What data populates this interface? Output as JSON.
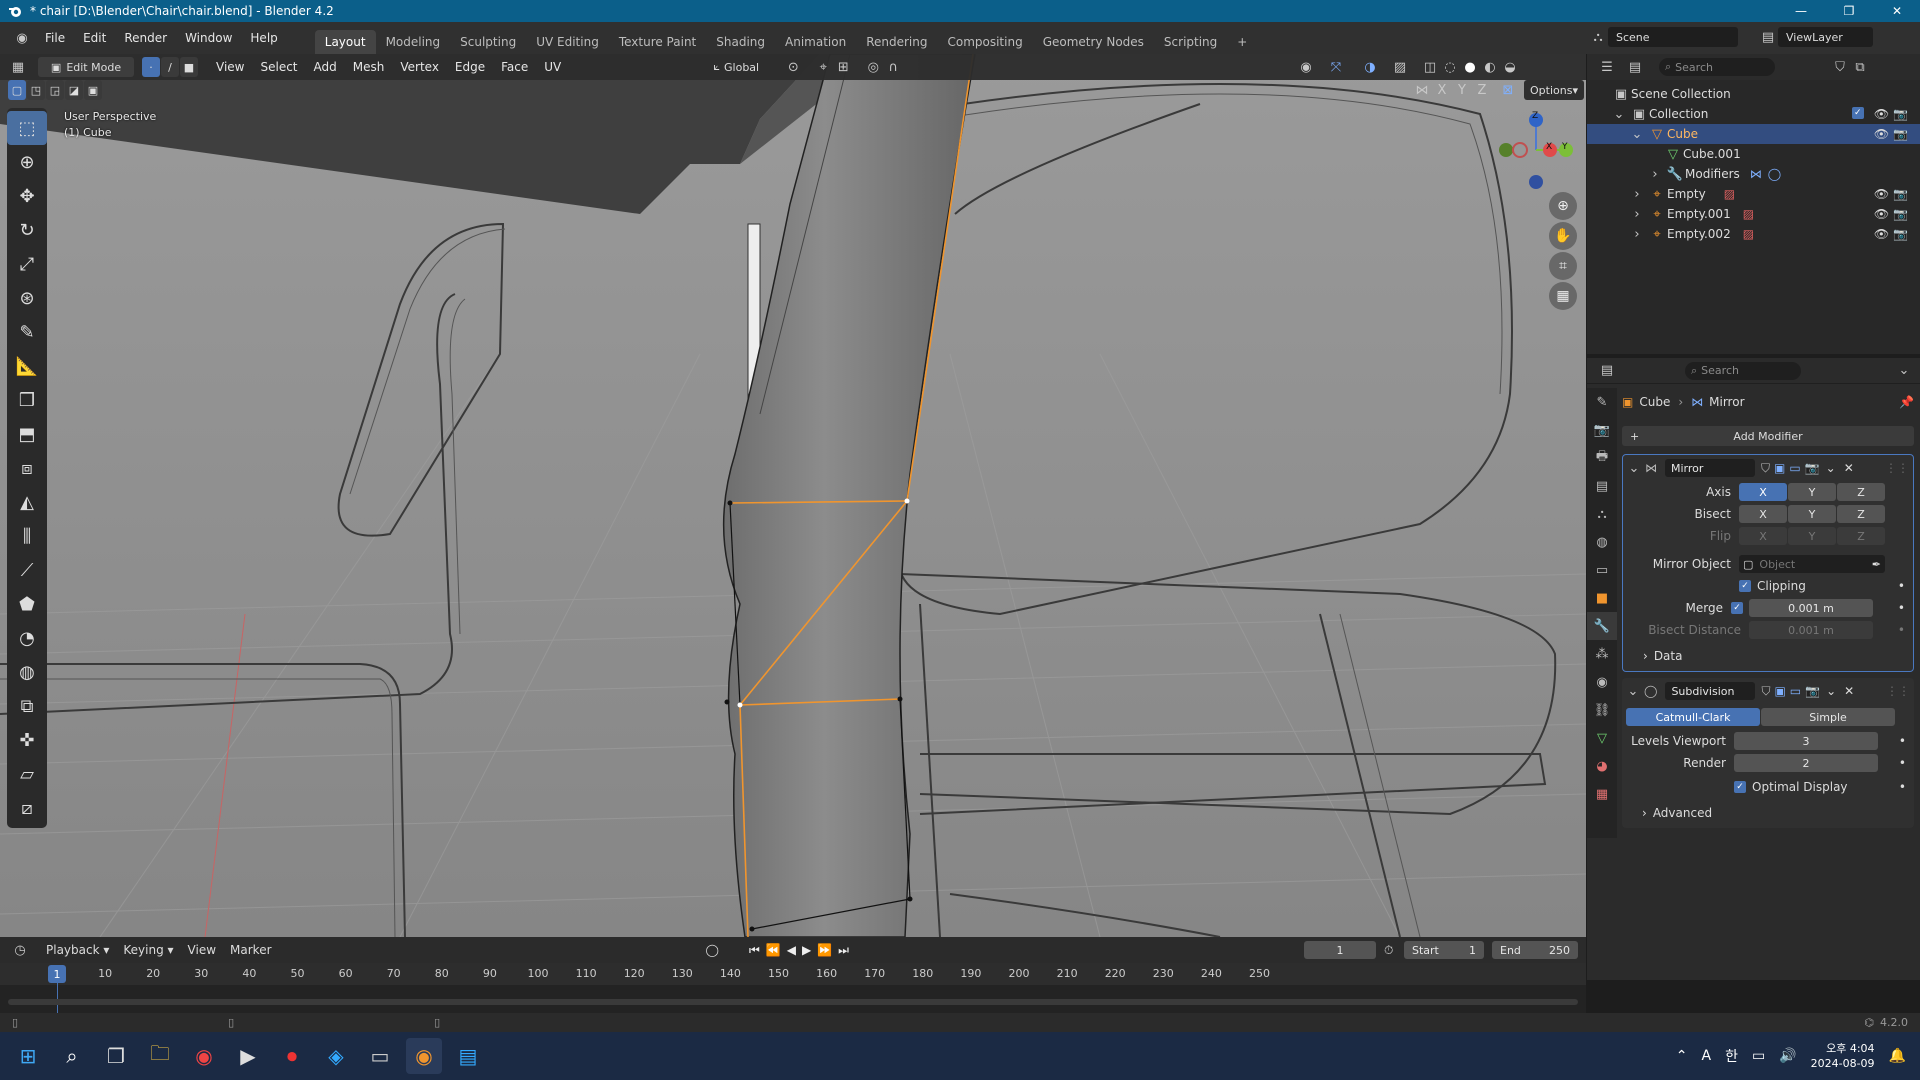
{
  "window": {
    "title": "* chair [D:\\Blender\\Chair\\chair.blend] - Blender 4.2",
    "controls": [
      "—",
      "❐",
      "✕"
    ]
  },
  "menus": [
    "File",
    "Edit",
    "Render",
    "Window",
    "Help"
  ],
  "workspaces": [
    "Layout",
    "Modeling",
    "Sculpting",
    "UV Editing",
    "Texture Paint",
    "Shading",
    "Animation",
    "Rendering",
    "Compositing",
    "Geometry Nodes",
    "Scripting"
  ],
  "active_workspace": "Layout",
  "scene": {
    "label": "Scene",
    "view_layer": "ViewLayer"
  },
  "viewport": {
    "mode": "Edit Mode",
    "menus": [
      "View",
      "Select",
      "Add",
      "Mesh",
      "Vertex",
      "Edge",
      "Face",
      "UV"
    ],
    "orientation": "Global",
    "overlay_text_1": "User Perspective",
    "overlay_text_2": "(1) Cube",
    "options_label": "Options",
    "axis_labels": [
      "X",
      "Y",
      "Z"
    ],
    "gizmo": {
      "x": "X",
      "y": "Y",
      "z": "Z"
    }
  },
  "outliner": {
    "search_placeholder": "Search",
    "scene_collection": "Scene Collection",
    "items": [
      {
        "name": "Collection",
        "depth": 1
      },
      {
        "name": "Cube",
        "depth": 2,
        "selected": true
      },
      {
        "name": "Cube.001",
        "depth": 3
      },
      {
        "name": "Modifiers",
        "depth": 3
      },
      {
        "name": "Empty",
        "depth": 2
      },
      {
        "name": "Empty.001",
        "depth": 2
      },
      {
        "name": "Empty.002",
        "depth": 2
      }
    ]
  },
  "properties": {
    "search_placeholder": "Search",
    "breadcrumb_object": "Cube",
    "breadcrumb_modifier": "Mirror",
    "add_modifier": "Add Modifier",
    "mirror": {
      "name": "Mirror",
      "axis_label": "Axis",
      "bisect_label": "Bisect",
      "flip_label": "Flip",
      "xyz": [
        "X",
        "Y",
        "Z"
      ],
      "mirror_object_label": "Mirror Object",
      "mirror_object_placeholder": "Object",
      "clipping_label": "Clipping",
      "merge_label": "Merge",
      "merge_value": "0.001 m",
      "bisect_distance_label": "Bisect Distance",
      "bisect_distance_value": "0.001 m",
      "data_label": "Data"
    },
    "subdivision": {
      "name": "Subdivision",
      "catmull_label": "Catmull-Clark",
      "simple_label": "Simple",
      "levels_viewport_label": "Levels Viewport",
      "levels_viewport_value": "3",
      "render_label": "Render",
      "render_value": "2",
      "optimal_display_label": "Optimal Display",
      "advanced_label": "Advanced"
    }
  },
  "timeline": {
    "menus": [
      "Playback",
      "Keying",
      "View",
      "Marker"
    ],
    "current_frame": "1",
    "start_label": "Start",
    "start_value": "1",
    "end_label": "End",
    "end_value": "250",
    "ticks": [
      "1",
      "10",
      "20",
      "30",
      "40",
      "50",
      "60",
      "70",
      "80",
      "90",
      "100",
      "110",
      "120",
      "130",
      "140",
      "150",
      "160",
      "170",
      "180",
      "190",
      "200",
      "210",
      "220",
      "230",
      "240",
      "250"
    ]
  },
  "statusbar": {
    "version": "4.2.0"
  },
  "taskbar": {
    "tray_lang": "A",
    "tray_ime": "한",
    "time": "오후 4:04",
    "date": "2024-08-09"
  },
  "colors": {
    "accent": "#4772b3",
    "selection_orange": "#f0952e",
    "titlebar": "#0b5f8a",
    "viewport_bg": "#8c8c8c"
  }
}
